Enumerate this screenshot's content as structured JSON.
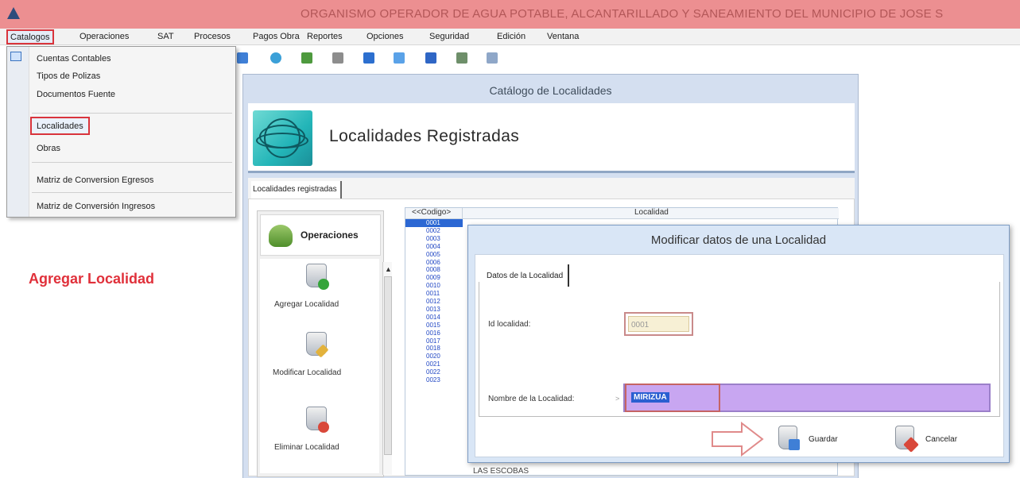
{
  "app": {
    "title": "ORGANISMO OPERADOR DE AGUA POTABLE, ALCANTARILLADO Y SANEAMIENTO DEL MUNICIPIO DE JOSE S"
  },
  "menubar": {
    "items": [
      "Catalogos",
      "Operaciones",
      "SAT",
      "Procesos",
      "Pagos Obra",
      "Reportes",
      "Opciones",
      "Seguridad",
      "Edición",
      "Ventana"
    ]
  },
  "dropdown": {
    "items": [
      "Cuentas Contables",
      "Tipos de Polizas",
      "Documentos Fuente",
      "Localidades",
      "Obras",
      "Matriz de Conversion Egresos",
      "Matriz de Conversión Ingresos"
    ]
  },
  "annotation": {
    "agregar": "Agregar Localidad"
  },
  "catalog": {
    "title": "Catálogo de Localidades",
    "heading": "Localidades Registradas",
    "tab": "Localidades registradas",
    "operations": {
      "header": "Operaciones",
      "buttons": [
        "Agregar Localidad",
        "Modificar Localidad",
        "Eliminar Localidad"
      ]
    },
    "table": {
      "columns": [
        "<<Codigo>",
        "Localidad"
      ],
      "codes": [
        "0001",
        "0002",
        "0003",
        "0004",
        "0005",
        "0006",
        "0008",
        "0009",
        "0010",
        "0011",
        "0012",
        "0013",
        "0014",
        "0015",
        "0016",
        "0017",
        "0018",
        "0020",
        "0021",
        "0022",
        "0023"
      ],
      "last_locality": "LAS ESCOBAS"
    }
  },
  "dialog": {
    "title": "Modificar datos de una Localidad",
    "tab": "Datos de la Localidad",
    "id_label": "Id localidad:",
    "id_value": "0001",
    "name_label": "Nombre de la Localidad:",
    "name_value": "MIRIZUA",
    "save": "Guardar",
    "cancel": "Cancelar"
  },
  "colors": {
    "titlebar": "#ec8f91",
    "highlight_border": "#d9343c",
    "annotation_text": "#e0303a",
    "selection": "#2a5fd1",
    "name_field": "#c8a6f1"
  }
}
